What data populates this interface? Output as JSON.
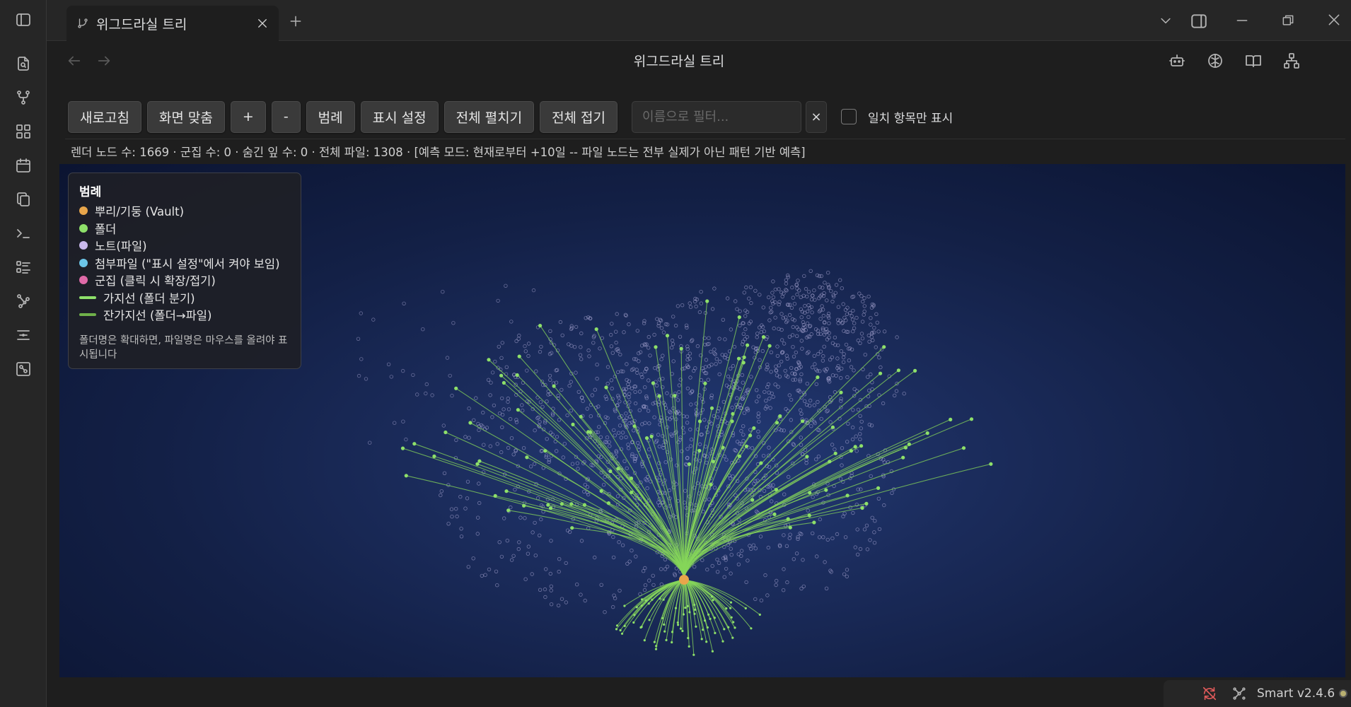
{
  "tab": {
    "title": "위그드라실 트리"
  },
  "header": {
    "title": "위그드라실 트리"
  },
  "toolbar": {
    "buttons": [
      "새로고침",
      "화면 맞춤",
      "+",
      "-",
      "범례",
      "표시 설정",
      "전체 펼치기",
      "전체 접기"
    ],
    "filter_placeholder": "이름으로 필터...",
    "clear_label": "×",
    "match_only_label": "일치 항목만 표시",
    "match_only_checked": false
  },
  "status_text": "렌더 노드 수: 1669 · 군집 수: 0 · 숨긴 잎 수: 0 · 전체 파일: 1308 · [예측 모드: 현재로부터 +10일 -- 파일 노드는 전부 실제가 아닌 패턴 기반 예측]",
  "legend": {
    "title": "범례",
    "items": [
      {
        "kind": "dot",
        "color": "#e8a54b",
        "label": "뿌리/기둥 (Vault)"
      },
      {
        "kind": "dot",
        "color": "#8ee06a",
        "label": "폴더"
      },
      {
        "kind": "dot",
        "color": "#c9b8ec",
        "label": "노트(파일)"
      },
      {
        "kind": "dot",
        "color": "#6cc6e8",
        "label": "첨부파일 (\"표시 설정\"에서 켜야 보임)"
      },
      {
        "kind": "dot",
        "color": "#e06aa8",
        "label": "군집 (클릭 시 확장/접기)"
      },
      {
        "kind": "line",
        "color": "#8ee06a",
        "label": "가지선 (폴더 분기)"
      },
      {
        "kind": "line",
        "color": "#6fb04a",
        "label": "잔가지선 (폴더→파일)"
      }
    ],
    "note": "폴더명은 확대하면, 파일명은 마우스를 올려야 표시됩니다"
  },
  "statusbar": {
    "smart_label": "Smart v2.4.6"
  },
  "graph_colors": {
    "root": "#e8a54b",
    "folder": "#8ee06a",
    "note": "#b9b4e0",
    "branch": "#86d65a"
  }
}
